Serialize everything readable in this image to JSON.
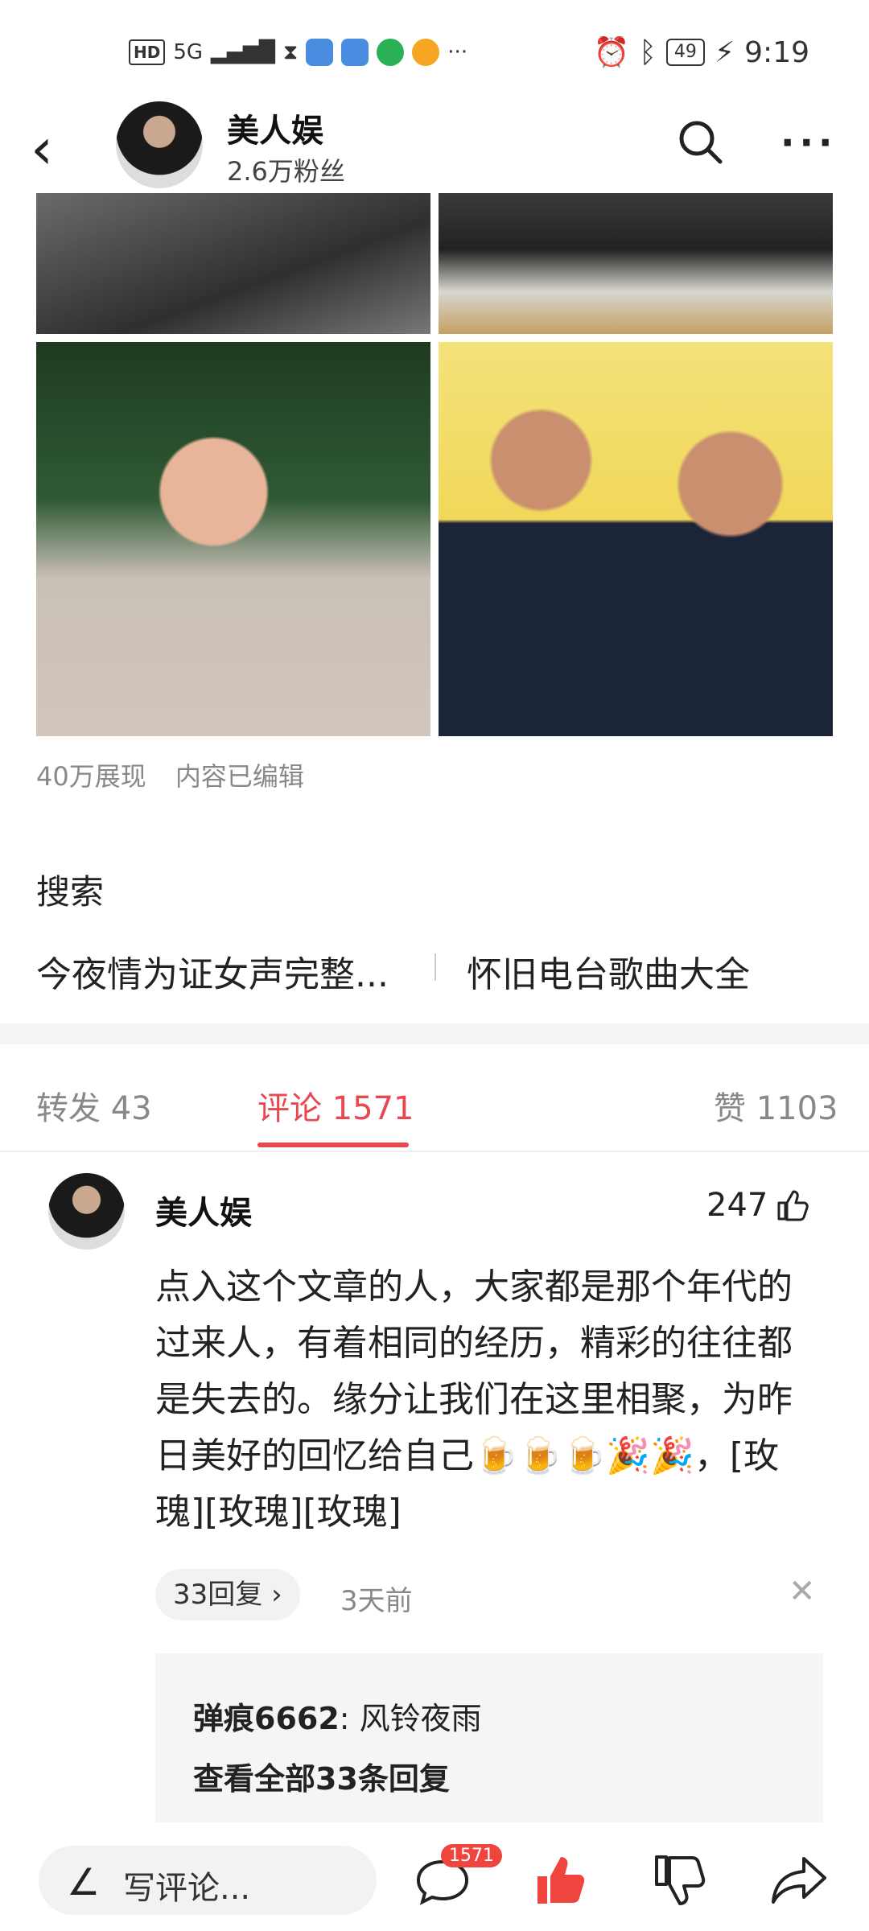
{
  "status_bar": {
    "hd": "HD",
    "network": "5G",
    "battery": "49",
    "time": "9:19",
    "dots": "···"
  },
  "header": {
    "back_icon": "‹",
    "author": "美人娱",
    "fans": "2.6万粉丝",
    "more": "···"
  },
  "article": {
    "views": "40万展现",
    "edited": "内容已编辑"
  },
  "search": {
    "title": "搜索",
    "suggestions": [
      "今夜情为证女声完整...",
      "怀旧电台歌曲大全"
    ]
  },
  "tabs": {
    "forward": "转发 43",
    "comments": "评论 1571",
    "likes": "赞 1103"
  },
  "comment": {
    "name": "美人娱",
    "likes": "247",
    "text": "点入这个文章的人，大家都是那个年代的过来人，有着相同的经历，精彩的往往都是失去的。缘分让我们在这里相聚，为昨日美好的回忆给自己🍺🍺🍺🎉🎉，[玫瑰][玫瑰][玫瑰]",
    "replies_label": "33回复 ›",
    "time": "3天前",
    "close": "✕",
    "reply": {
      "user": "弹痕6662",
      "text": ": 风铃夜雨"
    },
    "view_all": "查看全部33条回复"
  },
  "bottom_bar": {
    "write_placeholder": "写评论...",
    "comment_badge": "1571"
  },
  "colors": {
    "accent": "#e8484f",
    "badge": "#f0443f"
  }
}
